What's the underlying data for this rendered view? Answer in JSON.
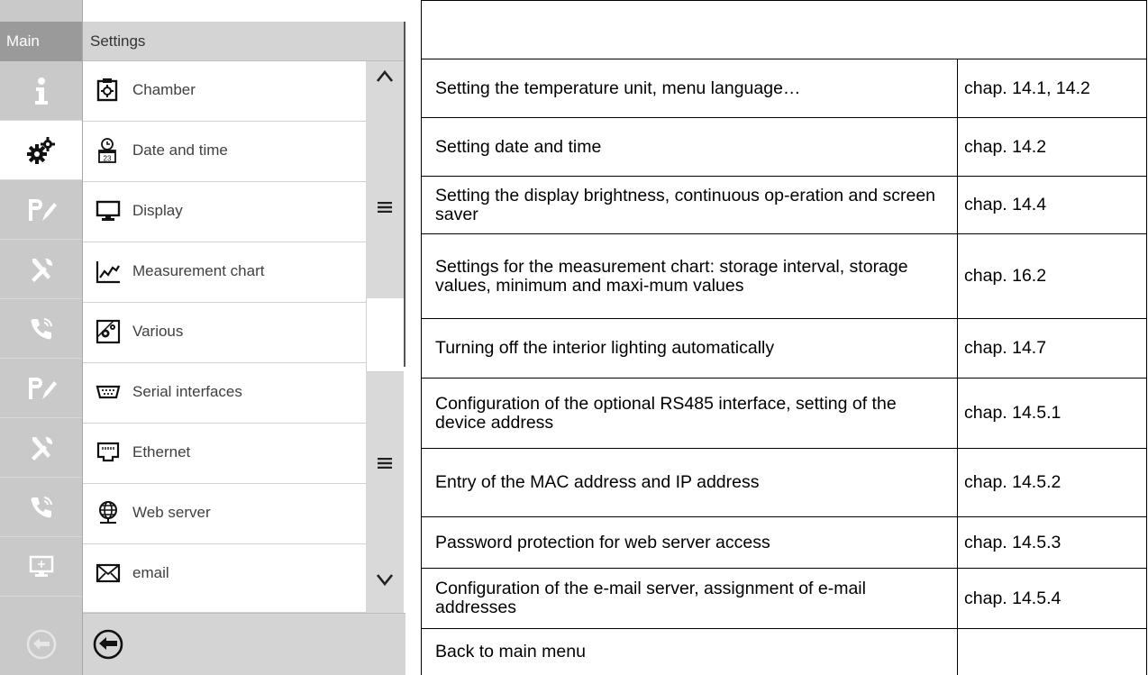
{
  "device": {
    "sidebar_header": "Main",
    "submenu_header": "Settings",
    "sidebar_icons": [
      "info-icon",
      "gears-icon",
      "pen-icon",
      "tools-icon",
      "phone-icon",
      "pen-icon",
      "tools-icon",
      "phone-icon",
      "monitor-icon",
      "back-icon"
    ],
    "menu_items": [
      {
        "label": "Chamber",
        "icon": "chamber-icon"
      },
      {
        "label": "Date and time",
        "icon": "calendar-clock-icon"
      },
      {
        "label": "Display",
        "icon": "monitor-icon"
      },
      {
        "label": "Measurement chart",
        "icon": "chart-icon"
      },
      {
        "label": "Various",
        "icon": "gear-box-icon"
      },
      {
        "label": "Serial interfaces",
        "icon": "serial-port-icon"
      },
      {
        "label": "Ethernet",
        "icon": "ethernet-port-icon"
      },
      {
        "label": "Web server",
        "icon": "globe-icon"
      },
      {
        "label": "email",
        "icon": "envelope-icon"
      }
    ],
    "scrollbar": {
      "up_glyph": "^",
      "down_glyph": "v",
      "grip_glyph": "≡"
    },
    "back_icon": "back-arrow-icon"
  },
  "reference_table": {
    "rows": [
      {
        "desc": "",
        "chap": ""
      },
      {
        "desc": "Setting the temperature unit, menu language…",
        "chap": "chap. 14.1, 14.2"
      },
      {
        "desc": "Setting date and time",
        "chap": "chap. 14.2"
      },
      {
        "desc": "Setting the display brightness, continuous op-eration and screen saver",
        "chap": "chap. 14.4"
      },
      {
        "desc": "Settings for the measurement chart: storage interval, storage values, minimum and maxi-mum values",
        "chap": "chap. 16.2"
      },
      {
        "desc": "Turning off the interior lighting automatically",
        "chap": "chap. 14.7"
      },
      {
        "desc": "Configuration of the optional RS485 interface, setting of the device address",
        "chap": "chap. 14.5.1"
      },
      {
        "desc": "Entry of the MAC address and IP address",
        "chap": "chap. 14.5.2"
      },
      {
        "desc": "Password protection for web server access",
        "chap": "chap. 14.5.3"
      },
      {
        "desc": "Configuration of the e-mail server, assignment of e-mail addresses",
        "chap": "chap. 14.5.4"
      },
      {
        "desc": "Back to main menu",
        "chap": ""
      }
    ]
  }
}
